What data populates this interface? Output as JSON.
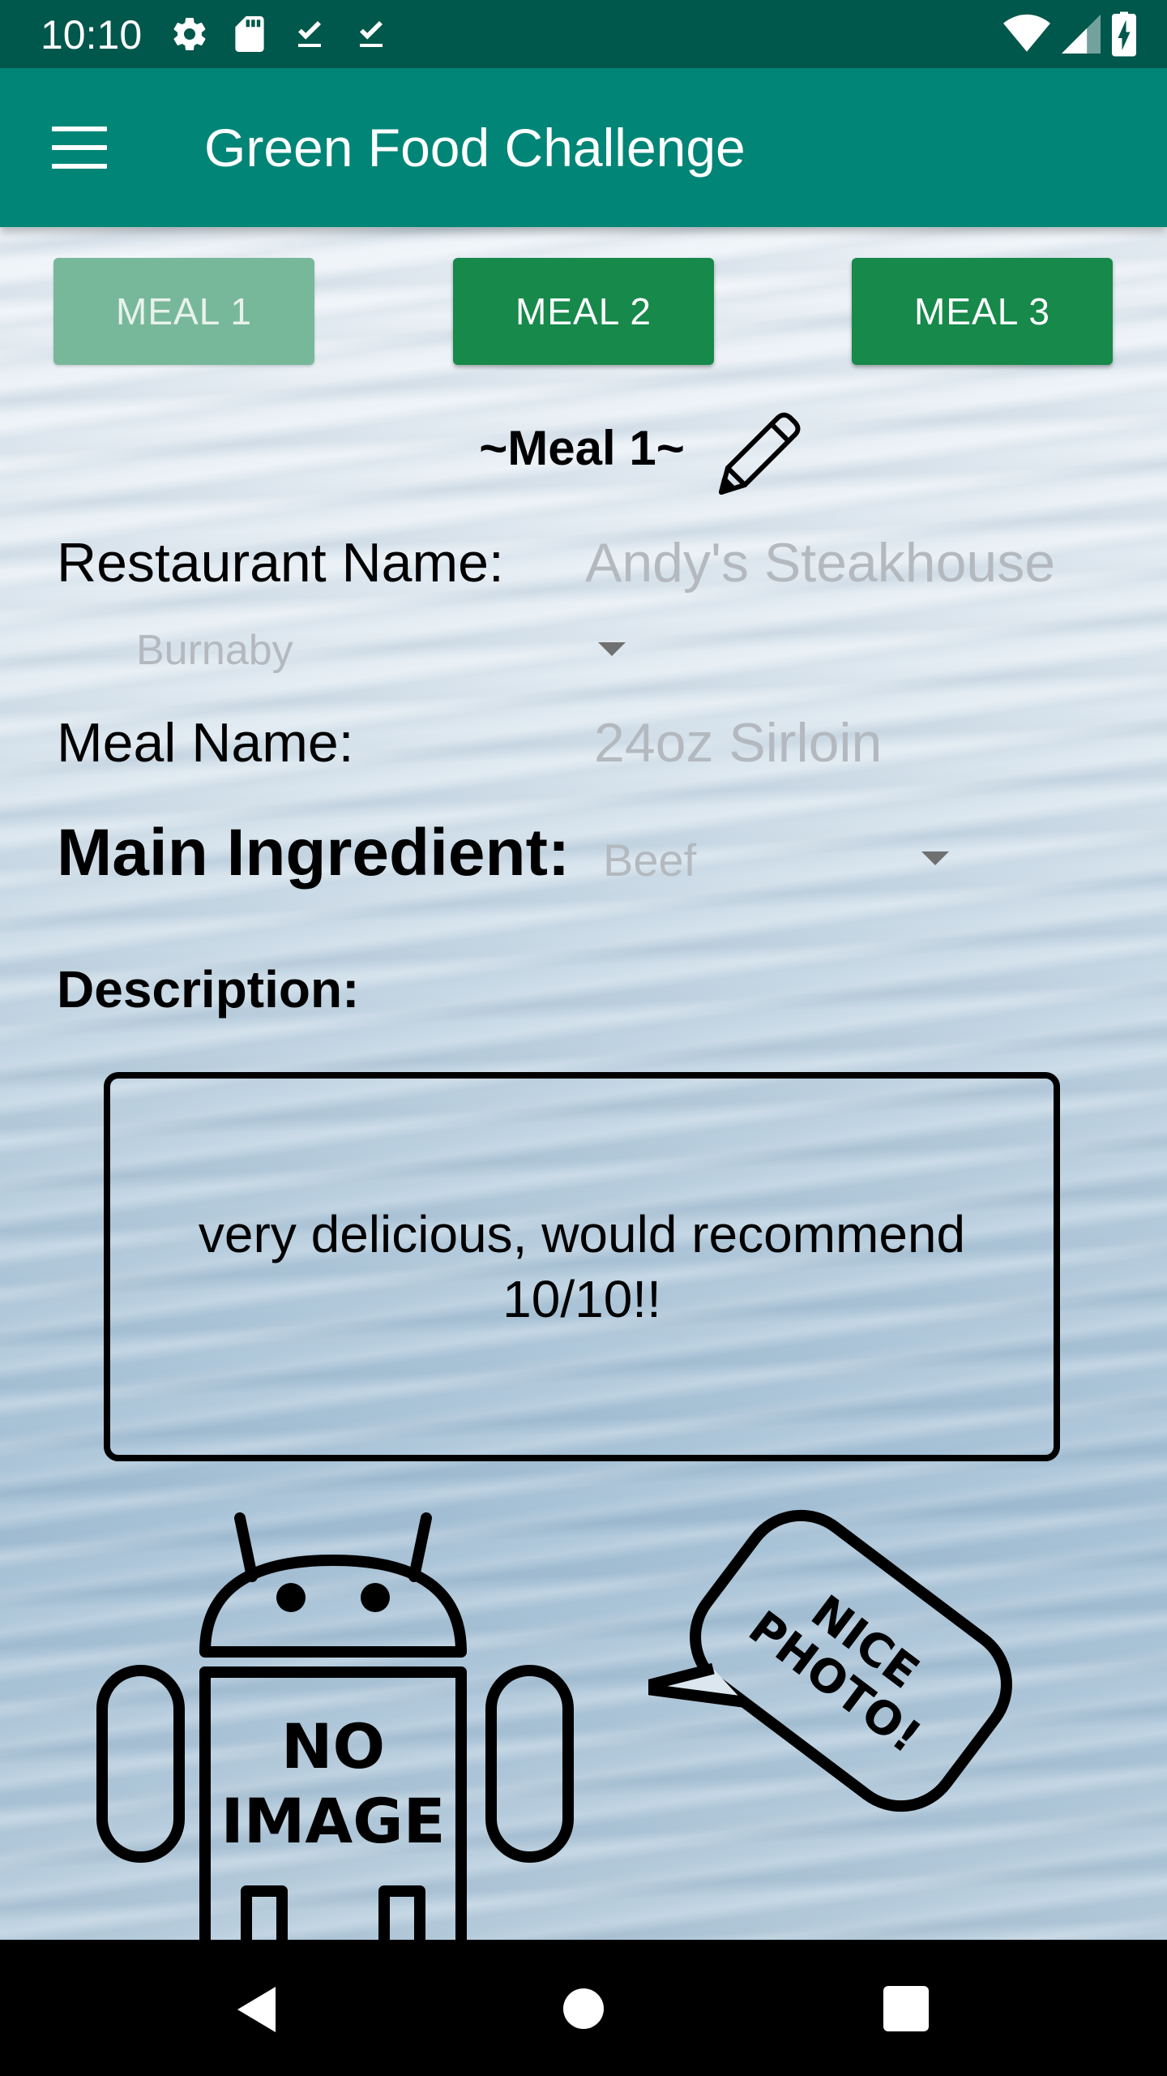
{
  "status_bar": {
    "time": "10:10",
    "icons_left": [
      "gear-icon",
      "sd-card-icon",
      "download-done-icon",
      "download-done-icon"
    ],
    "icons_right": [
      "wifi-icon",
      "signal-icon",
      "battery-charging-icon"
    ]
  },
  "app_bar": {
    "menu_icon": "hamburger-menu-icon",
    "title": "Green Food Challenge"
  },
  "meal_tabs": [
    {
      "label": "MEAL 1",
      "state": "selected"
    },
    {
      "label": "MEAL 2",
      "state": "normal"
    },
    {
      "label": "MEAL 3",
      "state": "normal"
    }
  ],
  "meal_heading": {
    "title": "~Meal 1~",
    "edit_icon": "pencil-icon"
  },
  "form": {
    "restaurant_label": "Restaurant Name:",
    "restaurant_value": "Andy's Steakhouse",
    "location_value": "Burnaby",
    "meal_name_label": "Meal Name:",
    "meal_name_value": "24oz Sirloin",
    "main_ingredient_label": "Main Ingredient:",
    "main_ingredient_value": "Beef",
    "description_label": "Description:",
    "description_value": "very delicious, would recommend 10/10!!"
  },
  "images": {
    "no_image_text_line1": "NO",
    "no_image_text_line2": "IMAGE",
    "nice_photo_line1": "NICE",
    "nice_photo_line2": "PHOTO!"
  },
  "colors": {
    "status_bar": "#00574b",
    "app_bar": "#008577",
    "button_green": "#17894a",
    "button_selected": "#78b89a",
    "hint_grey": "#b3b9bf"
  },
  "nav_bar": {
    "buttons": [
      "back-icon",
      "home-icon",
      "recents-icon"
    ]
  }
}
